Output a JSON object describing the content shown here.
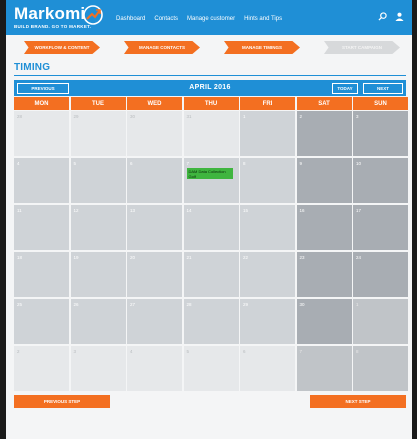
{
  "brand": {
    "name": "Markomi",
    "tagline": "BUILD BRAND. GO TO MARKET."
  },
  "nav": {
    "items": [
      "Dashboard",
      "Contacts",
      "Manage customer",
      "Hints and Tips"
    ]
  },
  "icons": {
    "search": "search-icon",
    "user": "user-icon"
  },
  "steps": [
    {
      "label": "WORKFLOW & CONTENT",
      "state": "done"
    },
    {
      "label": "MANAGE CONTACTS",
      "state": "done"
    },
    {
      "label": "MANAGE TIMINGS",
      "state": "current"
    },
    {
      "label": "START CAMPAIGN",
      "state": "disabled"
    }
  ],
  "page_title": "TIMING",
  "calendar": {
    "month_label": "APRIL 2016",
    "prev_label": "PREVIOUS",
    "today_label": "TODAY",
    "next_label": "NEXT",
    "days_of_week": [
      "MON",
      "TUE",
      "WED",
      "THU",
      "FRI",
      "SAT",
      "SUN"
    ],
    "weeks": [
      [
        {
          "d": "28",
          "o": true
        },
        {
          "d": "29",
          "o": true
        },
        {
          "d": "30",
          "o": true
        },
        {
          "d": "31",
          "o": true
        },
        {
          "d": "1"
        },
        {
          "d": "2"
        },
        {
          "d": "3"
        }
      ],
      [
        {
          "d": "4"
        },
        {
          "d": "5"
        },
        {
          "d": "6"
        },
        {
          "d": "7",
          "event": "DAM Data Collection Golf"
        },
        {
          "d": "8"
        },
        {
          "d": "9"
        },
        {
          "d": "10"
        }
      ],
      [
        {
          "d": "11"
        },
        {
          "d": "12"
        },
        {
          "d": "13"
        },
        {
          "d": "14"
        },
        {
          "d": "15"
        },
        {
          "d": "16"
        },
        {
          "d": "17"
        }
      ],
      [
        {
          "d": "18"
        },
        {
          "d": "19"
        },
        {
          "d": "20"
        },
        {
          "d": "21"
        },
        {
          "d": "22"
        },
        {
          "d": "23"
        },
        {
          "d": "24"
        }
      ],
      [
        {
          "d": "25"
        },
        {
          "d": "26"
        },
        {
          "d": "27"
        },
        {
          "d": "28"
        },
        {
          "d": "29"
        },
        {
          "d": "30"
        },
        {
          "d": "1",
          "o": true
        }
      ],
      [
        {
          "d": "2",
          "o": true
        },
        {
          "d": "3",
          "o": true
        },
        {
          "d": "4",
          "o": true
        },
        {
          "d": "5",
          "o": true
        },
        {
          "d": "6",
          "o": true
        },
        {
          "d": "7",
          "o": true
        },
        {
          "d": "8",
          "o": true
        }
      ]
    ]
  },
  "footer": {
    "previous_step": "PREVIOUS STEP",
    "next_step": "NEXT STEP"
  },
  "colors": {
    "brand_blue": "#1f8fd6",
    "accent_orange": "#f36f21",
    "event_green": "#3fb53f",
    "cell_weekday": "#cfd3d7",
    "cell_weekend": "#a8adb3",
    "cell_outside": "#e6e8ea"
  }
}
